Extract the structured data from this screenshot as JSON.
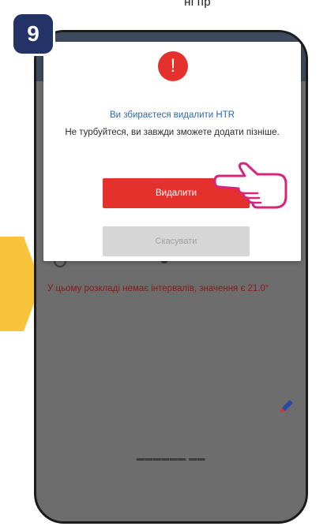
{
  "top_text": "ні пр",
  "step": {
    "number": "9"
  },
  "background": {
    "warning": "У цьому розкладі немає інтервалів, значення є 21.0°"
  },
  "dialog": {
    "title": "Ви збираєтеся видалити HTR",
    "message": "Не турбуйтеся, ви завжди зможете додати пізніше.",
    "delete_label": "Видалити",
    "cancel_label": "Скасувати",
    "alert_glyph": "!"
  },
  "colors": {
    "badge": "#233367",
    "accent_red": "#e5312c",
    "arrow_yellow": "#f7c33b",
    "hand_pink": "#d6247f",
    "title_blue": "#2a6bb3"
  },
  "icons": [
    "alert-icon",
    "pointing-hand-icon",
    "edit-pencil-icon",
    "side-arrow-icon"
  ]
}
